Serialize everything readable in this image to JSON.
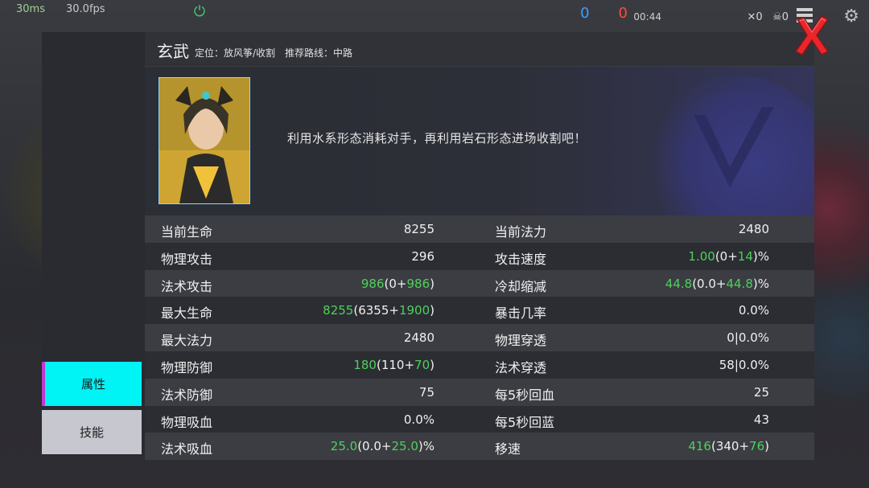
{
  "hud": {
    "ping": "30ms",
    "fps": "30.0fps",
    "score_blue": "0",
    "score_red": "0",
    "timer": "00:44",
    "kills": "0",
    "deaths": "0"
  },
  "hero": {
    "name": "玄武",
    "meta": "定位：放风筝/收割　推荐路线：中路",
    "tip": "利用水系形态消耗对手，再利用岩石形态进场收割吧！"
  },
  "tabs": [
    {
      "label": "属性",
      "active": true
    },
    {
      "label": "技能",
      "active": false
    }
  ],
  "stats": [
    {
      "l1": "当前生命",
      "v1": [
        [
          "8255",
          ""
        ]
      ],
      "l2": "当前法力",
      "v2": [
        [
          "2480",
          ""
        ]
      ]
    },
    {
      "l1": "物理攻击",
      "v1": [
        [
          "296",
          ""
        ]
      ],
      "l2": "攻击速度",
      "v2": [
        [
          "1.00",
          "g"
        ],
        [
          "(0+",
          ""
        ],
        [
          "14",
          "g"
        ],
        [
          ")%",
          ""
        ]
      ]
    },
    {
      "l1": "法术攻击",
      "v1": [
        [
          "986",
          "g"
        ],
        [
          "(0+",
          ""
        ],
        [
          "986",
          "g"
        ],
        [
          ")",
          ""
        ]
      ],
      "l2": "冷却缩减",
      "v2": [
        [
          "44.8",
          "g"
        ],
        [
          "(0.0+",
          ""
        ],
        [
          "44.8",
          "g"
        ],
        [
          ")%",
          ""
        ]
      ]
    },
    {
      "l1": "最大生命",
      "v1": [
        [
          "8255",
          "g"
        ],
        [
          "(6355+",
          ""
        ],
        [
          "1900",
          "g"
        ],
        [
          ")",
          ""
        ]
      ],
      "l2": "暴击几率",
      "v2": [
        [
          "0.0%",
          ""
        ]
      ]
    },
    {
      "l1": "最大法力",
      "v1": [
        [
          "2480",
          ""
        ]
      ],
      "l2": "物理穿透",
      "v2": [
        [
          "0|0.0%",
          ""
        ]
      ]
    },
    {
      "l1": "物理防御",
      "v1": [
        [
          "180",
          "g"
        ],
        [
          "(110+",
          ""
        ],
        [
          "70",
          "g"
        ],
        [
          ")",
          ""
        ]
      ],
      "l2": "法术穿透",
      "v2": [
        [
          "58|0.0%",
          ""
        ]
      ]
    },
    {
      "l1": "法术防御",
      "v1": [
        [
          "75",
          ""
        ]
      ],
      "l2": "每5秒回血",
      "v2": [
        [
          "25",
          ""
        ]
      ]
    },
    {
      "l1": "物理吸血",
      "v1": [
        [
          "0.0%",
          ""
        ]
      ],
      "l2": "每5秒回蓝",
      "v2": [
        [
          "43",
          ""
        ]
      ]
    },
    {
      "l1": "法术吸血",
      "v1": [
        [
          "25.0",
          "g"
        ],
        [
          "(0.0+",
          ""
        ],
        [
          "25.0",
          "g"
        ],
        [
          ")%",
          ""
        ]
      ],
      "l2": "移速",
      "v2": [
        [
          "416",
          "g"
        ],
        [
          "(340+",
          ""
        ],
        [
          "76",
          "g"
        ],
        [
          ")",
          ""
        ]
      ]
    }
  ],
  "colors": {
    "bonus_green": "#4fd15a",
    "tab_active": "#00f3f5",
    "tab_active_edge": "#c13ad0",
    "close_red": "#e8262b"
  }
}
